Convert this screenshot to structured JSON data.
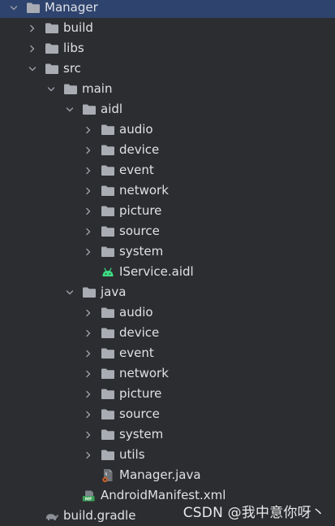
{
  "tree": {
    "selected_node": "Manager",
    "nodes": [
      {
        "label": "Manager",
        "depth": 0,
        "state": "expanded",
        "icon": "folder-icon"
      },
      {
        "label": "build",
        "depth": 1,
        "state": "collapsed",
        "icon": "folder-icon"
      },
      {
        "label": "libs",
        "depth": 1,
        "state": "collapsed",
        "icon": "folder-icon"
      },
      {
        "label": "src",
        "depth": 1,
        "state": "expanded",
        "icon": "folder-icon"
      },
      {
        "label": "main",
        "depth": 2,
        "state": "expanded",
        "icon": "folder-icon"
      },
      {
        "label": "aidl",
        "depth": 3,
        "state": "expanded",
        "icon": "folder-icon"
      },
      {
        "label": "audio",
        "depth": 4,
        "state": "collapsed",
        "icon": "folder-icon"
      },
      {
        "label": "device",
        "depth": 4,
        "state": "collapsed",
        "icon": "folder-icon"
      },
      {
        "label": "event",
        "depth": 4,
        "state": "collapsed",
        "icon": "folder-icon"
      },
      {
        "label": "network",
        "depth": 4,
        "state": "collapsed",
        "icon": "folder-icon"
      },
      {
        "label": "picture",
        "depth": 4,
        "state": "collapsed",
        "icon": "folder-icon"
      },
      {
        "label": "source",
        "depth": 4,
        "state": "collapsed",
        "icon": "folder-icon"
      },
      {
        "label": "system",
        "depth": 4,
        "state": "collapsed",
        "icon": "folder-icon"
      },
      {
        "label": "IService.aidl",
        "depth": 4,
        "state": "leaf",
        "icon": "android-icon"
      },
      {
        "label": "java",
        "depth": 3,
        "state": "expanded",
        "icon": "folder-icon"
      },
      {
        "label": "audio",
        "depth": 4,
        "state": "collapsed",
        "icon": "folder-icon"
      },
      {
        "label": "device",
        "depth": 4,
        "state": "collapsed",
        "icon": "folder-icon"
      },
      {
        "label": "event",
        "depth": 4,
        "state": "collapsed",
        "icon": "folder-icon"
      },
      {
        "label": "network",
        "depth": 4,
        "state": "collapsed",
        "icon": "folder-icon"
      },
      {
        "label": "picture",
        "depth": 4,
        "state": "collapsed",
        "icon": "folder-icon"
      },
      {
        "label": "source",
        "depth": 4,
        "state": "collapsed",
        "icon": "folder-icon"
      },
      {
        "label": "system",
        "depth": 4,
        "state": "collapsed",
        "icon": "folder-icon"
      },
      {
        "label": "utils",
        "depth": 4,
        "state": "collapsed",
        "icon": "folder-icon"
      },
      {
        "label": "Manager.java",
        "depth": 4,
        "state": "leaf",
        "icon": "java-file-icon"
      },
      {
        "label": "AndroidManifest.xml",
        "depth": 3,
        "state": "leaf",
        "icon": "manifest-icon"
      },
      {
        "label": "build.gradle",
        "depth": 1,
        "state": "leaf",
        "icon": "gradle-icon"
      }
    ]
  },
  "watermark": "CSDN @我中意你呀丶",
  "colors": {
    "background": "#2b2d30",
    "selection": "#2e436e",
    "text": "#dfe1e5",
    "folder": "#a9adb3",
    "android": "#3ddc84",
    "chevron": "#9da0a8"
  }
}
